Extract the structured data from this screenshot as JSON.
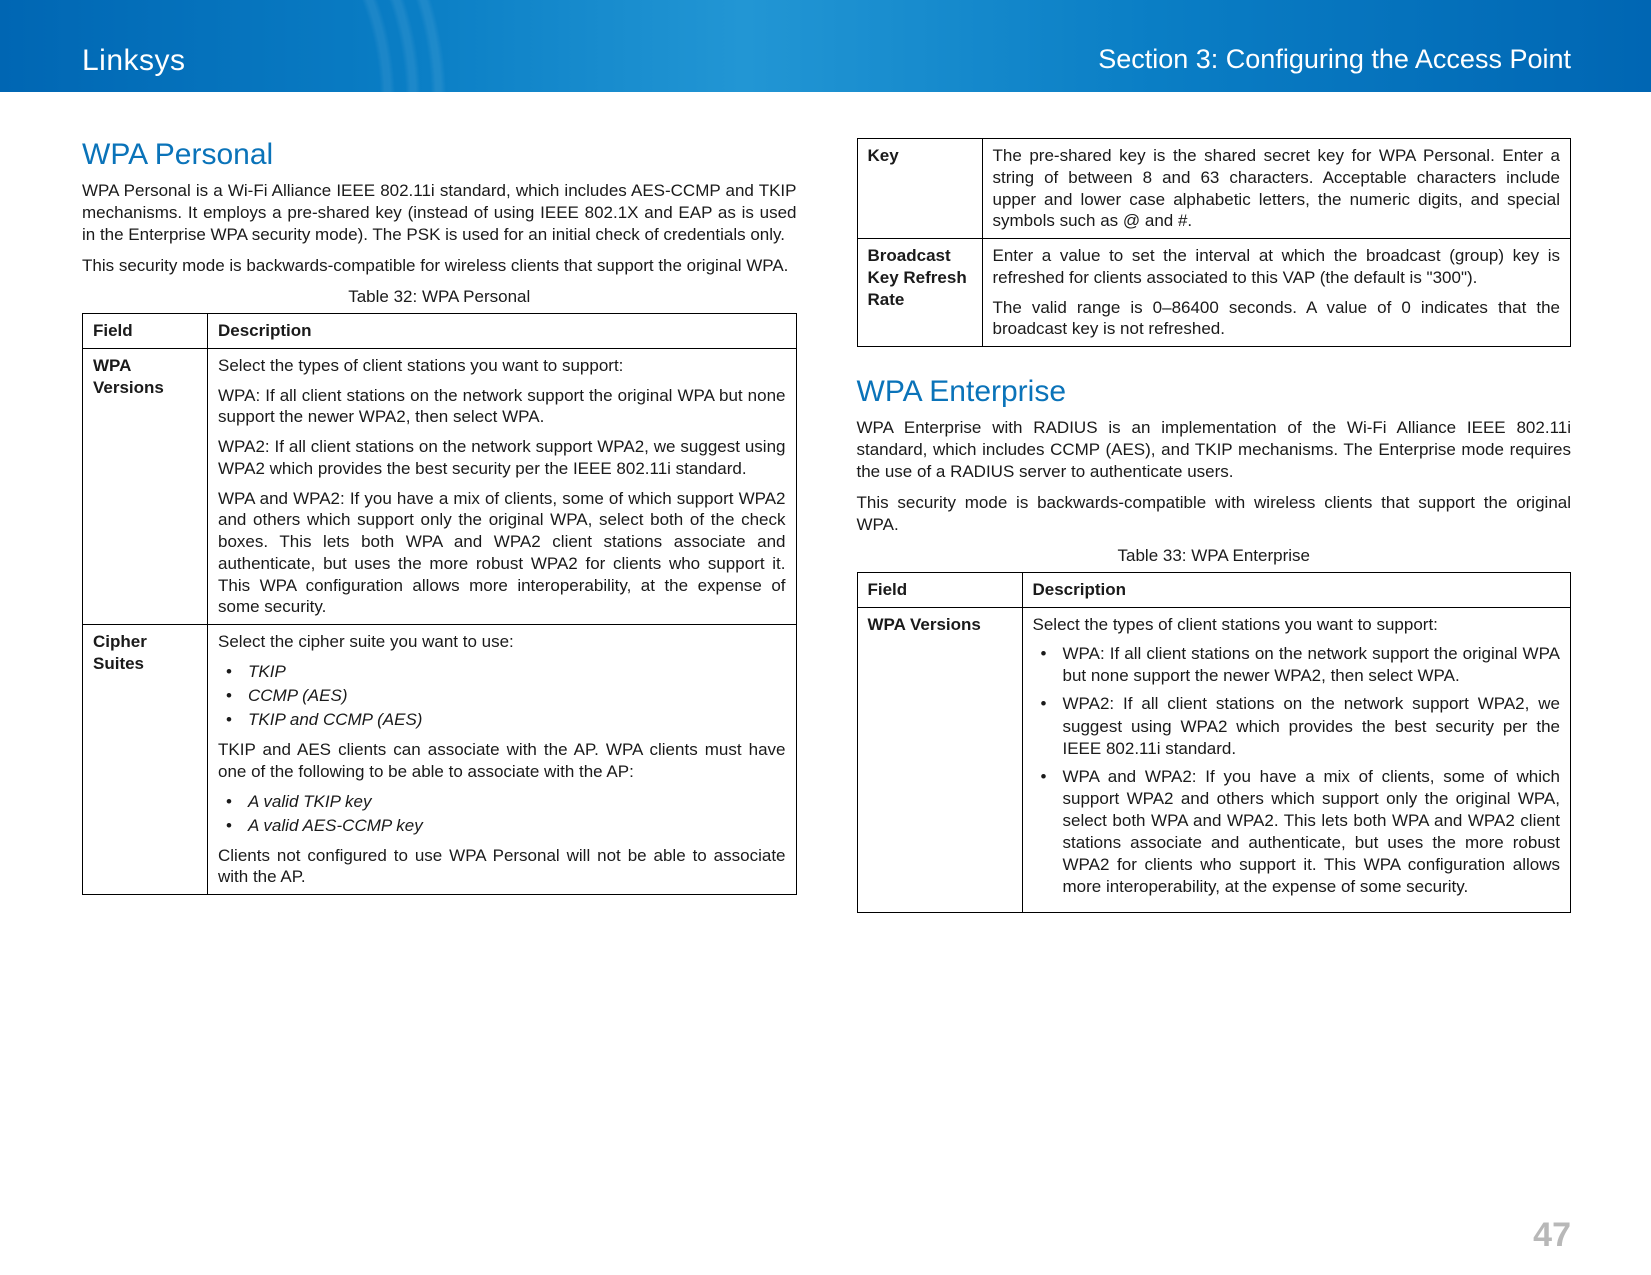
{
  "header": {
    "brand": "Linksys",
    "section": "Section 3:  Configuring the Access Point"
  },
  "page_number": "47",
  "left": {
    "h2": "WPA Personal",
    "p1": "WPA Personal is a Wi-Fi Alliance IEEE 802.11i standard, which includes AES-CCMP and TKIP mechanisms. It employs a pre-shared key (instead of using IEEE 802.1X and EAP as is used in the Enterprise WPA security mode). The PSK is used for an initial check of credentials only.",
    "p2": "This security mode is backwards-compatible for wireless clients that support the original WPA.",
    "table_caption": "Table 32: WPA Personal",
    "th_field": "Field",
    "th_desc": "Description",
    "row1_label": "WPA Versions",
    "row1_p1": "Select the types of client stations you want to support:",
    "row1_p2": "WPA: If all client stations on the network support the original WPA but none support the newer WPA2, then select WPA.",
    "row1_p3": "WPA2: If all client stations on the network support WPA2, we suggest using WPA2 which provides the best security per the IEEE 802.11i standard.",
    "row1_p4": "WPA and WPA2: If you have a mix of clients, some of which support WPA2 and others which support only the original WPA, select both of the check boxes. This lets both WPA and WPA2 client stations associate and authenticate, but uses the more robust WPA2 for clients who support it. This WPA configuration allows more interoperability, at the expense of some security.",
    "row2_label": "Cipher Suites",
    "row2_p1": "Select the cipher suite you want to use:",
    "row2_b1": "TKIP",
    "row2_b2": "CCMP (AES)",
    "row2_b3": "TKIP and CCMP (AES)",
    "row2_p2": "TKIP and AES clients can associate with the AP. WPA clients must have one of the following to be able to associate with the AP:",
    "row2_b4": "A valid TKIP key",
    "row2_b5": "A valid AES-CCMP key",
    "row2_p3": "Clients not configured to use WPA Personal will not be able to associate with the AP."
  },
  "right": {
    "cont_row1_label": "Key",
    "cont_row1_p1": "The pre-shared key is the shared secret key for WPA Personal. Enter a string of between 8 and 63 characters. Acceptable characters include upper and lower case alphabetic letters, the numeric digits, and special symbols such as @ and #.",
    "cont_row2_label": "Broadcast Key Refresh Rate",
    "cont_row2_p1": "Enter a value to set the interval at which the broadcast (group) key is refreshed for clients associated to this VAP (the default is \"300\").",
    "cont_row2_p2": "The valid range is 0–86400 seconds. A value of 0 indicates that the broadcast key is not refreshed.",
    "h2": "WPA Enterprise",
    "p1": "WPA Enterprise with RADIUS is an implementation of the Wi-Fi Alliance IEEE 802.11i standard, which includes CCMP (AES), and TKIP mechanisms. The Enterprise mode requires the use of a RADIUS server to authenticate users.",
    "p2": "This security mode is backwards-compatible with wireless clients that support the original WPA.",
    "table_caption": "Table 33: WPA Enterprise",
    "th_field": "Field",
    "th_desc": "Description",
    "row1_label": "WPA Versions",
    "row1_p1": "Select the types of client stations you want to support:",
    "row1_b1": "WPA: If all client stations on the network support the original WPA but none support the newer WPA2, then select WPA.",
    "row1_b2": "WPA2: If all client stations on the network support WPA2, we suggest using WPA2 which provides the best security per the IEEE 802.11i standard.",
    "row1_b3": "WPA and WPA2: If you have a mix of clients, some of which support WPA2 and others which support only the original WPA, select both WPA and WPA2. This lets both WPA and WPA2 client stations associate and authenticate, but uses the more robust WPA2 for clients who support it. This WPA configuration allows more interoperability, at the expense of some security."
  }
}
